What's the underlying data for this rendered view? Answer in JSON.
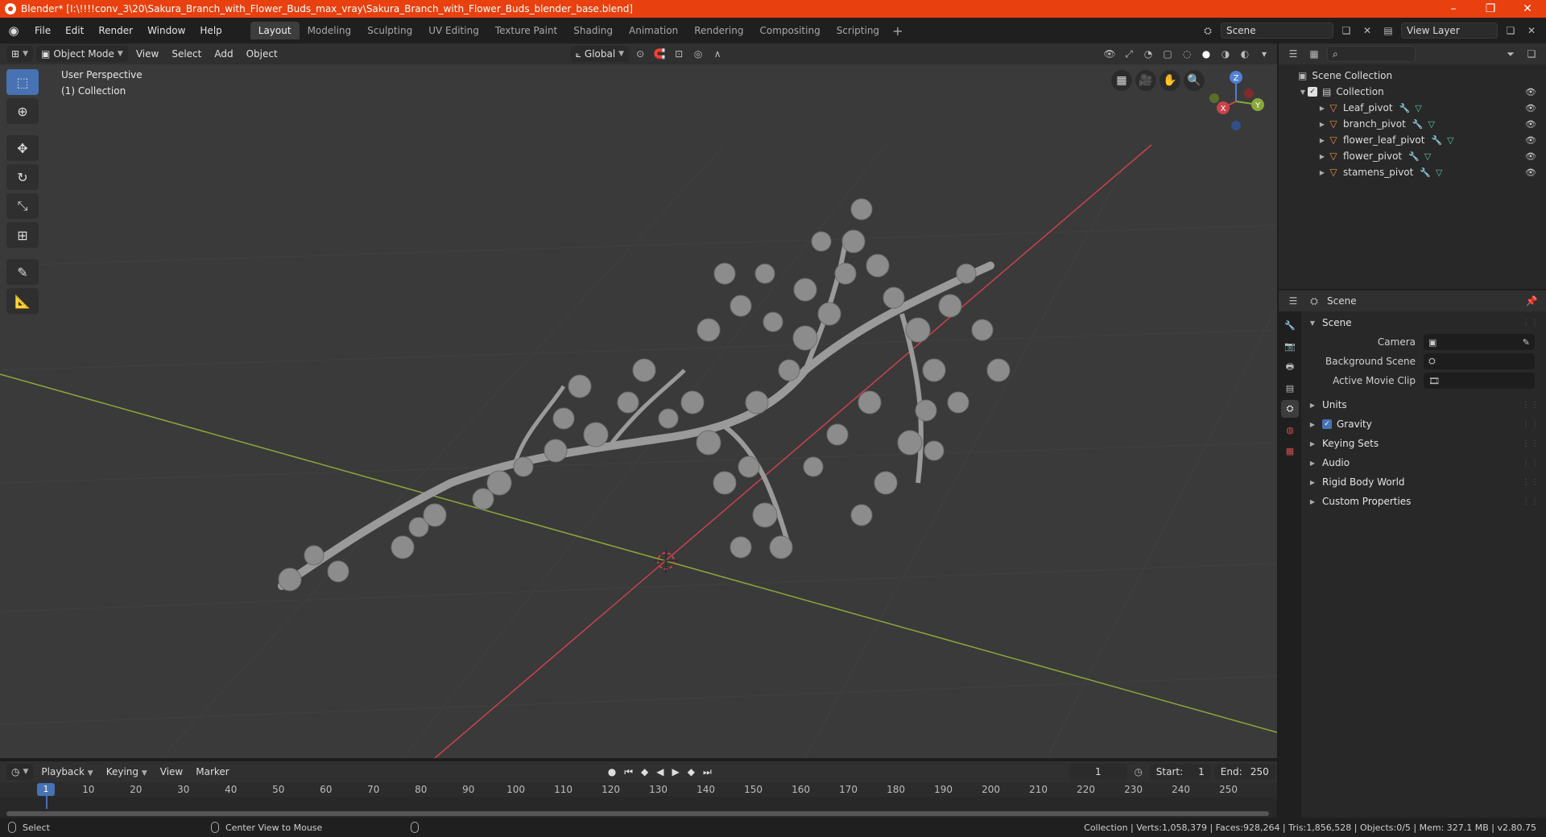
{
  "window": {
    "title": "Blender* [I:\\!!!!conv_3\\20\\Sakura_Branch_with_Flower_Buds_max_vray\\Sakura_Branch_with_Flower_Buds_blender_base.blend]",
    "minimize": "–",
    "restore": "❐",
    "close": "✕"
  },
  "menubar": {
    "menus": [
      "File",
      "Edit",
      "Render",
      "Window",
      "Help"
    ],
    "workspaces": [
      "Layout",
      "Modeling",
      "Sculpting",
      "UV Editing",
      "Texture Paint",
      "Shading",
      "Animation",
      "Rendering",
      "Compositing",
      "Scripting"
    ],
    "active_workspace": "Layout",
    "scene_name": "Scene",
    "view_layer": "View Layer"
  },
  "viewport_header": {
    "mode": "Object Mode",
    "menus": [
      "View",
      "Select",
      "Add",
      "Object"
    ],
    "orientation": "Global"
  },
  "viewport": {
    "perspective_label": "User Perspective",
    "collection_label": "(1) Collection",
    "gizmo": {
      "x": "X",
      "y": "Y",
      "z": "Z"
    }
  },
  "outliner": {
    "root": "Scene Collection",
    "collection": "Collection",
    "objects": [
      "Leaf_pivot",
      "branch_pivot",
      "flower_leaf_pivot",
      "flower_pivot",
      "stamens_pivot"
    ]
  },
  "properties": {
    "context": "Scene",
    "panel_title": "Scene",
    "fields": [
      {
        "label": "Camera",
        "value": ""
      },
      {
        "label": "Background Scene",
        "value": ""
      },
      {
        "label": "Active Movie Clip",
        "value": ""
      }
    ],
    "subpanels": [
      "Units",
      "Gravity",
      "Keying Sets",
      "Audio",
      "Rigid Body World",
      "Custom Properties"
    ],
    "gravity_checked": true
  },
  "timeline": {
    "menus": [
      "Playback",
      "Keying",
      "View",
      "Marker"
    ],
    "current_frame": "1",
    "start_label": "Start:",
    "start": "1",
    "end_label": "End:",
    "end": "250",
    "ticks": [
      "10",
      "20",
      "30",
      "40",
      "50",
      "60",
      "70",
      "80",
      "90",
      "100",
      "110",
      "120",
      "130",
      "140",
      "150",
      "160",
      "170",
      "180",
      "190",
      "200",
      "210",
      "220",
      "230",
      "240",
      "250"
    ]
  },
  "statusbar": {
    "select": "Select",
    "center_view": "Center View to Mouse",
    "stats": "Collection | Verts:1,058,379 | Faces:928,264 | Tris:1,856,528 | Objects:0/5 | Mem: 327.1 MB | v2.80.75"
  },
  "colors": {
    "titlebar": "#e8400f",
    "accent": "#4772b3",
    "axis_x": "#c9434b",
    "axis_y": "#8aa83a",
    "mesh": "#e8903a"
  }
}
